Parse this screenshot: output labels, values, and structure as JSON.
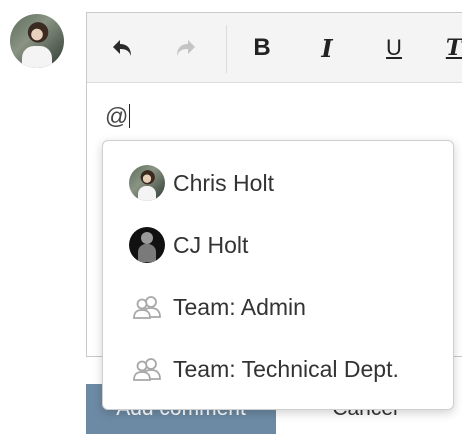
{
  "editor": {
    "text_value": "@"
  },
  "toolbar": {
    "undo_icon": "undo-arrow-icon",
    "redo_icon": "redo-arrow-icon",
    "bold_label": "B",
    "italic_label": "I",
    "underline_label": "U",
    "more_format_label": "T"
  },
  "mention_suggestions": [
    {
      "label": "Chris Holt",
      "icon": "user-avatar"
    },
    {
      "label": "CJ Holt",
      "icon": "user-avatar"
    },
    {
      "label": "Team: Admin",
      "icon": "team-icon"
    },
    {
      "label": "Team: Technical Dept.",
      "icon": "team-icon"
    }
  ],
  "actions": {
    "add_comment_label": "Add comment",
    "cancel_label": "Cancel"
  },
  "colors": {
    "primary_button": "#6d8aa4",
    "team_icon": "#a0a0a0"
  }
}
